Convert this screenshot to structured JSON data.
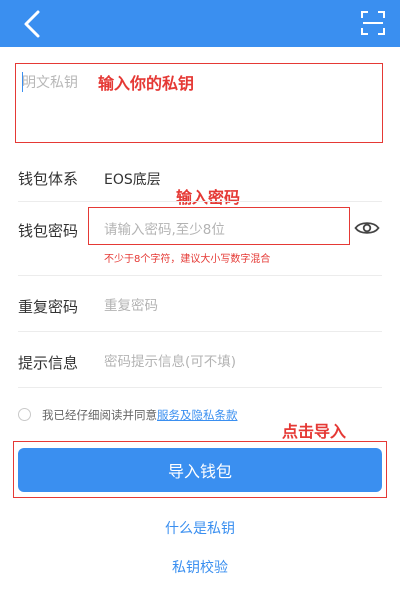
{
  "header": {
    "back_icon": "back-arrow-icon",
    "scan_icon": "scan-icon",
    "background_color": "#3a8ff0"
  },
  "private_key": {
    "placeholder": "明文私钥",
    "value": ""
  },
  "annotations": {
    "enter_key": "输入你的私钥",
    "enter_password": "输入密码",
    "click_import": "点击导入",
    "color": "#e53935"
  },
  "wallet_system": {
    "label": "钱包体系",
    "value": "EOS底层"
  },
  "wallet_password": {
    "label": "钱包密码",
    "placeholder": "请输入密码,至少8位",
    "value": "",
    "hint": "不少于8个字符，建议大小写数字混合",
    "visibility_icon": "eye-icon"
  },
  "repeat_password": {
    "label": "重复密码",
    "placeholder": "重复密码",
    "value": ""
  },
  "password_hint": {
    "label": "提示信息",
    "placeholder": "密码提示信息(可不填)",
    "value": ""
  },
  "agreement": {
    "checked": false,
    "text": "我已经仔细阅读并同意",
    "link": "服务及隐私条款"
  },
  "import_button": {
    "label": "导入钱包"
  },
  "links": {
    "what_is_private_key": "什么是私钥",
    "verify_private_key": "私钥校验"
  }
}
